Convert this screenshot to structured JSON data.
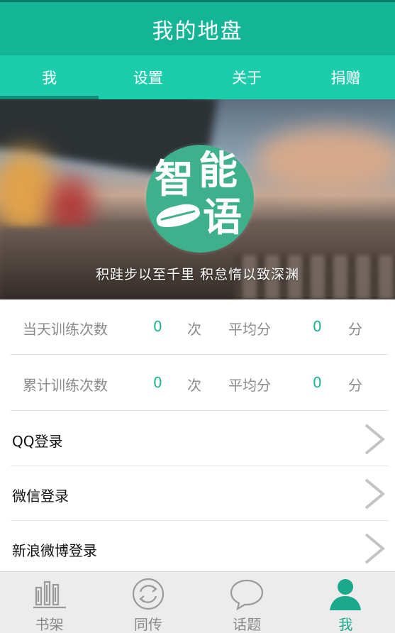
{
  "header": {
    "title": "我的地盘"
  },
  "tabs": [
    {
      "label": "我",
      "active": true
    },
    {
      "label": "设置",
      "active": false
    },
    {
      "label": "关于",
      "active": false
    },
    {
      "label": "捐赠",
      "active": false
    }
  ],
  "hero": {
    "logo_text": [
      "智",
      "能",
      "语"
    ],
    "slogan": "积跬步以至千里  积怠惰以致深渊"
  },
  "stats": [
    {
      "label": "当天训练次数",
      "count": "0",
      "count_unit": "次",
      "avg_label": "平均分",
      "avg": "0",
      "avg_unit": "分"
    },
    {
      "label": "累计训练次数",
      "count": "0",
      "count_unit": "次",
      "avg_label": "平均分",
      "avg": "0",
      "avg_unit": "分"
    }
  ],
  "logins": [
    {
      "label": "QQ登录"
    },
    {
      "label": "微信登录"
    },
    {
      "label": "新浪微博登录"
    }
  ],
  "bottom_nav": [
    {
      "label": "书架",
      "icon": "bookshelf-icon",
      "active": false
    },
    {
      "label": "同传",
      "icon": "sync-icon",
      "active": false
    },
    {
      "label": "话题",
      "icon": "chat-bubble-icon",
      "active": false
    },
    {
      "label": "我",
      "icon": "person-icon",
      "active": true
    }
  ],
  "colors": {
    "header_bg": "#14b596",
    "tabs_bg": "#1ccdab",
    "accent": "#1ab394",
    "active_nav": "#1aa98c"
  }
}
